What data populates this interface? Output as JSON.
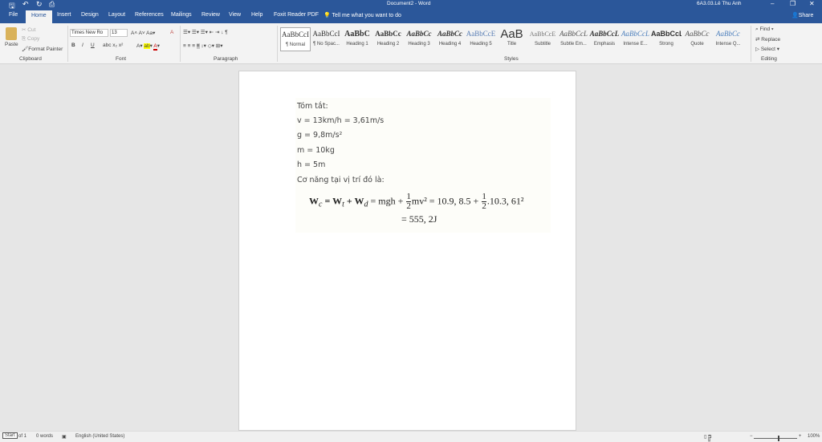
{
  "title": {
    "document": "Document2 - Word",
    "user": "6A3.03.Lê Thu Anh"
  },
  "tabs": [
    "File",
    "Home",
    "Insert",
    "Design",
    "Layout",
    "References",
    "Mailings",
    "Review",
    "View",
    "Help",
    "Foxit Reader PDF"
  ],
  "tell_me": "Tell me what you want to do",
  "share": "Share",
  "clipboard": {
    "paste": "Paste",
    "cut": "Cut",
    "copy": "Copy",
    "format_painter": "Format Painter",
    "label": "Clipboard"
  },
  "font": {
    "name": "Times New Ro",
    "size": "13",
    "label": "Font",
    "bold": "B",
    "italic": "I",
    "underline": "U"
  },
  "paragraph": {
    "label": "Paragraph"
  },
  "styles": {
    "label": "Styles",
    "items": [
      {
        "sample": "AaBbCcI",
        "name": "¶ Normal"
      },
      {
        "sample": "AaBbCcI",
        "name": "¶ No Spac..."
      },
      {
        "sample": "AaBbC",
        "name": "Heading 1"
      },
      {
        "sample": "AaBbCc",
        "name": "Heading 2"
      },
      {
        "sample": "AaBbCc",
        "name": "Heading 3"
      },
      {
        "sample": "AaBbCc",
        "name": "Heading 4"
      },
      {
        "sample": "AaBbCcE",
        "name": "Heading 5"
      },
      {
        "sample": "AaB",
        "name": "Title"
      },
      {
        "sample": "AaBbCcE",
        "name": "Subtitle"
      },
      {
        "sample": "AaBbCcL",
        "name": "Subtle Em..."
      },
      {
        "sample": "AaBbCcL",
        "name": "Emphasis"
      },
      {
        "sample": "AaBbCcL",
        "name": "Intense E..."
      },
      {
        "sample": "AaBbCcL",
        "name": "Strong"
      },
      {
        "sample": "AaBbCc",
        "name": "Quote"
      },
      {
        "sample": "AaBbCc",
        "name": "Intense Q..."
      }
    ]
  },
  "editing": {
    "find": "Find",
    "replace": "Replace",
    "select": "Select",
    "label": "Editing"
  },
  "document": {
    "lines": [
      "Tóm tắt:",
      "v = 13km/h = 3,61m/s",
      "g = 9,8m/s²",
      "m = 10kg",
      "h = 5m",
      "Cơ năng tại vị trí đó là:"
    ],
    "eq1a": "W",
    "eq1b": " = W",
    "eq1c": " + W",
    "eq1d": " = mgh + ",
    "eq1e": "mv² = 10.9, 8.5 + ",
    "eq1f": ".10.3, 61²",
    "sub_c": "c",
    "sub_t": "t",
    "sub_d": "d",
    "half_num": "1",
    "half_den": "2",
    "eq2": "= 555, 2J"
  },
  "status": {
    "start": "Start",
    "page": "of 1",
    "words": "0 words",
    "language": "English (United States)",
    "zoom": "100%"
  }
}
